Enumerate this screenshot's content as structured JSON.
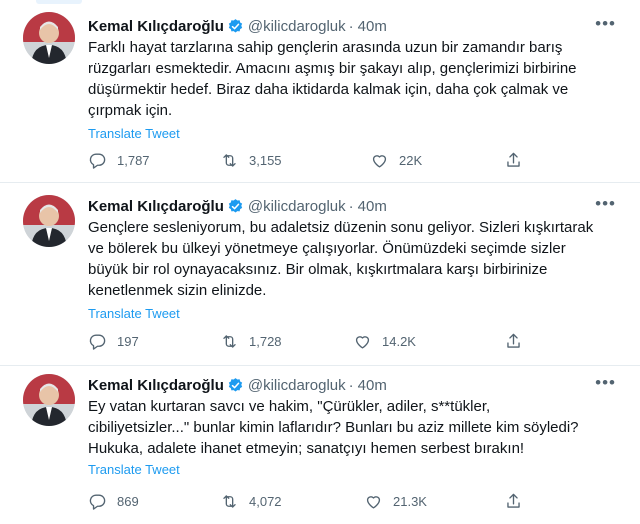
{
  "tweets": [
    {
      "name": "Kemal Kılıçdaroğlu",
      "handle": "@kilicdarogluk",
      "time": "40m",
      "text": "Farklı hayat tarzlarına sahip gençlerin arasında uzun bir zamandır barış\nrüzgarları esmektedir. Amacını aşmış bir şakayı alıp, gençlerimizi birbirine\ndüşürmektir hedef. Biraz daha iktidarda kalmak için, daha çok çalmak ve\nçırpmak için.",
      "translate": "Translate Tweet",
      "replies": "1,787",
      "retweets": "3,155",
      "likes": "22K"
    },
    {
      "name": "Kemal Kılıçdaroğlu",
      "handle": "@kilicdarogluk",
      "time": "40m",
      "text": "Gençlere sesleniyorum, bu adaletsiz düzenin sonu geliyor. Sizleri kışkırtarak\nve bölerek bu ülkeyi yönetmeye çalışıyorlar. Önümüzdeki seçimde sizler\nbüyük bir rol oynayacaksınız. Bir olmak, kışkırtmalara karşı birbirinize\nkenetlenmek sizin elinizde.",
      "translate": "Translate Tweet",
      "replies": "197",
      "retweets": "1,728",
      "likes": "14.2K"
    },
    {
      "name": "Kemal Kılıçdaroğlu",
      "handle": "@kilicdarogluk",
      "time": "40m",
      "text": "Ey vatan kurtaran savcı ve hakim, \"Çürükler, adiler, s**tükler,\ncibiliyetsizler...\" bunlar kimin laflarıdır? Bunları bu aziz millete kim söyledi?\nHukuka, adalete ihanet etmeyin; sanatçıyı hemen serbest bırakın!",
      "translate": "Translate Tweet",
      "replies": "869",
      "retweets": "4,072",
      "likes": "21.3K"
    }
  ],
  "colors": {
    "accent": "#1d9bf0",
    "muted": "#536471",
    "text": "#0f1419",
    "divider": "#e6ecf0"
  },
  "icons": [
    "verified-badge-icon",
    "more-icon",
    "reply-icon",
    "retweet-icon",
    "like-icon",
    "share-icon"
  ]
}
